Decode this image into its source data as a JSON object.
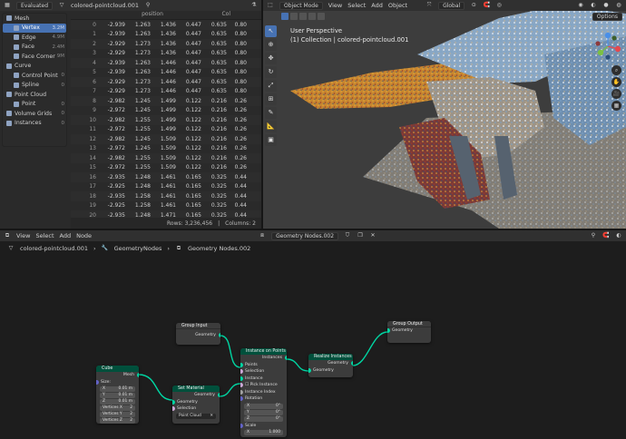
{
  "spreadsheet": {
    "mode": "Evaluated",
    "object_name": "colored-pointcloud.001",
    "col_header_position": "position",
    "col_header_col": "Col",
    "tree": [
      {
        "label": "Mesh",
        "count": "",
        "level": 0
      },
      {
        "label": "Vertex",
        "count": "3.2M",
        "level": 1,
        "selected": true
      },
      {
        "label": "Edge",
        "count": "4.9M",
        "level": 1
      },
      {
        "label": "Face",
        "count": "2.4M",
        "level": 1
      },
      {
        "label": "Face Corner",
        "count": "9M",
        "level": 1
      },
      {
        "label": "Curve",
        "count": "",
        "level": 0
      },
      {
        "label": "Control Point",
        "count": "0",
        "level": 1
      },
      {
        "label": "Spline",
        "count": "0",
        "level": 1
      },
      {
        "label": "Point Cloud",
        "count": "",
        "level": 0
      },
      {
        "label": "Point",
        "count": "0",
        "level": 1
      },
      {
        "label": "Volume Grids",
        "count": "0",
        "level": 0
      },
      {
        "label": "Instances",
        "count": "0",
        "level": 0
      }
    ],
    "rows": [
      [
        "0",
        "-2.939",
        "1.263",
        "1.436",
        "0.447",
        "0.635",
        "0.80"
      ],
      [
        "1",
        "-2.939",
        "1.263",
        "1.436",
        "0.447",
        "0.635",
        "0.80"
      ],
      [
        "2",
        "-2.929",
        "1.273",
        "1.436",
        "0.447",
        "0.635",
        "0.80"
      ],
      [
        "3",
        "-2.929",
        "1.273",
        "1.436",
        "0.447",
        "0.635",
        "0.80"
      ],
      [
        "4",
        "-2.939",
        "1.263",
        "1.446",
        "0.447",
        "0.635",
        "0.80"
      ],
      [
        "5",
        "-2.939",
        "1.263",
        "1.446",
        "0.447",
        "0.635",
        "0.80"
      ],
      [
        "6",
        "-2.929",
        "1.273",
        "1.446",
        "0.447",
        "0.635",
        "0.80"
      ],
      [
        "7",
        "-2.929",
        "1.273",
        "1.446",
        "0.447",
        "0.635",
        "0.80"
      ],
      [
        "8",
        "-2.982",
        "1.245",
        "1.499",
        "0.122",
        "0.216",
        "0.26"
      ],
      [
        "9",
        "-2.972",
        "1.245",
        "1.499",
        "0.122",
        "0.216",
        "0.26"
      ],
      [
        "10",
        "-2.982",
        "1.255",
        "1.499",
        "0.122",
        "0.216",
        "0.26"
      ],
      [
        "11",
        "-2.972",
        "1.255",
        "1.499",
        "0.122",
        "0.216",
        "0.26"
      ],
      [
        "12",
        "-2.982",
        "1.245",
        "1.509",
        "0.122",
        "0.216",
        "0.26"
      ],
      [
        "13",
        "-2.972",
        "1.245",
        "1.509",
        "0.122",
        "0.216",
        "0.26"
      ],
      [
        "14",
        "-2.982",
        "1.255",
        "1.509",
        "0.122",
        "0.216",
        "0.26"
      ],
      [
        "15",
        "-2.972",
        "1.255",
        "1.509",
        "0.122",
        "0.216",
        "0.26"
      ],
      [
        "16",
        "-2.935",
        "1.248",
        "1.461",
        "0.165",
        "0.325",
        "0.44"
      ],
      [
        "17",
        "-2.925",
        "1.248",
        "1.461",
        "0.165",
        "0.325",
        "0.44"
      ],
      [
        "18",
        "-2.935",
        "1.258",
        "1.461",
        "0.165",
        "0.325",
        "0.44"
      ],
      [
        "19",
        "-2.925",
        "1.258",
        "1.461",
        "0.165",
        "0.325",
        "0.44"
      ],
      [
        "20",
        "-2.935",
        "1.248",
        "1.471",
        "0.165",
        "0.325",
        "0.44"
      ],
      [
        "21",
        "-2.925",
        "1.248",
        "1.471",
        "0.165",
        "0.325",
        "0.44"
      ]
    ],
    "footer_rows": "Rows: 3,236,456",
    "footer_cols": "Columns: 2"
  },
  "viewport": {
    "mode": "Object Mode",
    "menu": [
      "View",
      "Select",
      "Add",
      "Object"
    ],
    "transform": "Global",
    "options": "Options",
    "perspective": "User Perspective",
    "collection_line": "(1) Collection | colored-pointcloud.001"
  },
  "node_editor": {
    "menu": [
      "View",
      "Select",
      "Add",
      "Node"
    ],
    "tree_name": "Geometry Nodes.002",
    "breadcrumb": [
      "colored-pointcloud.001",
      "GeometryNodes",
      "Geometry Nodes.002"
    ],
    "nodes": {
      "group_input": {
        "title": "Group Input",
        "out": "Geometry"
      },
      "group_output": {
        "title": "Group Output",
        "in": "Geometry"
      },
      "cube": {
        "title": "Cube",
        "out": "Mesh",
        "size_label": "Size:",
        "x": "0.01 m",
        "y": "0.01 m",
        "z": "0.01 m",
        "vx": "Vertices X",
        "vy": "Vertices Y",
        "vz": "Vertices Z",
        "vx_val": "2",
        "vy_val": "2",
        "vz_val": "2"
      },
      "set_material": {
        "title": "Set Material",
        "out": "Geometry",
        "in_geo": "Geometry",
        "in_sel": "Selection",
        "material": "Point Cloud"
      },
      "instance_on_points": {
        "title": "Instance on Points",
        "out": "Instances",
        "points": "Points",
        "selection": "Selection",
        "instance": "Instance",
        "pick": "Pick Instance",
        "index": "Instance Index",
        "rotation": "Rotation",
        "scale": "Scale",
        "rx": "0°",
        "ry": "0°",
        "rz": "0°",
        "sx": "1.000"
      },
      "realize": {
        "title": "Realize Instances",
        "out": "Geometry",
        "in": "Geometry"
      }
    }
  }
}
